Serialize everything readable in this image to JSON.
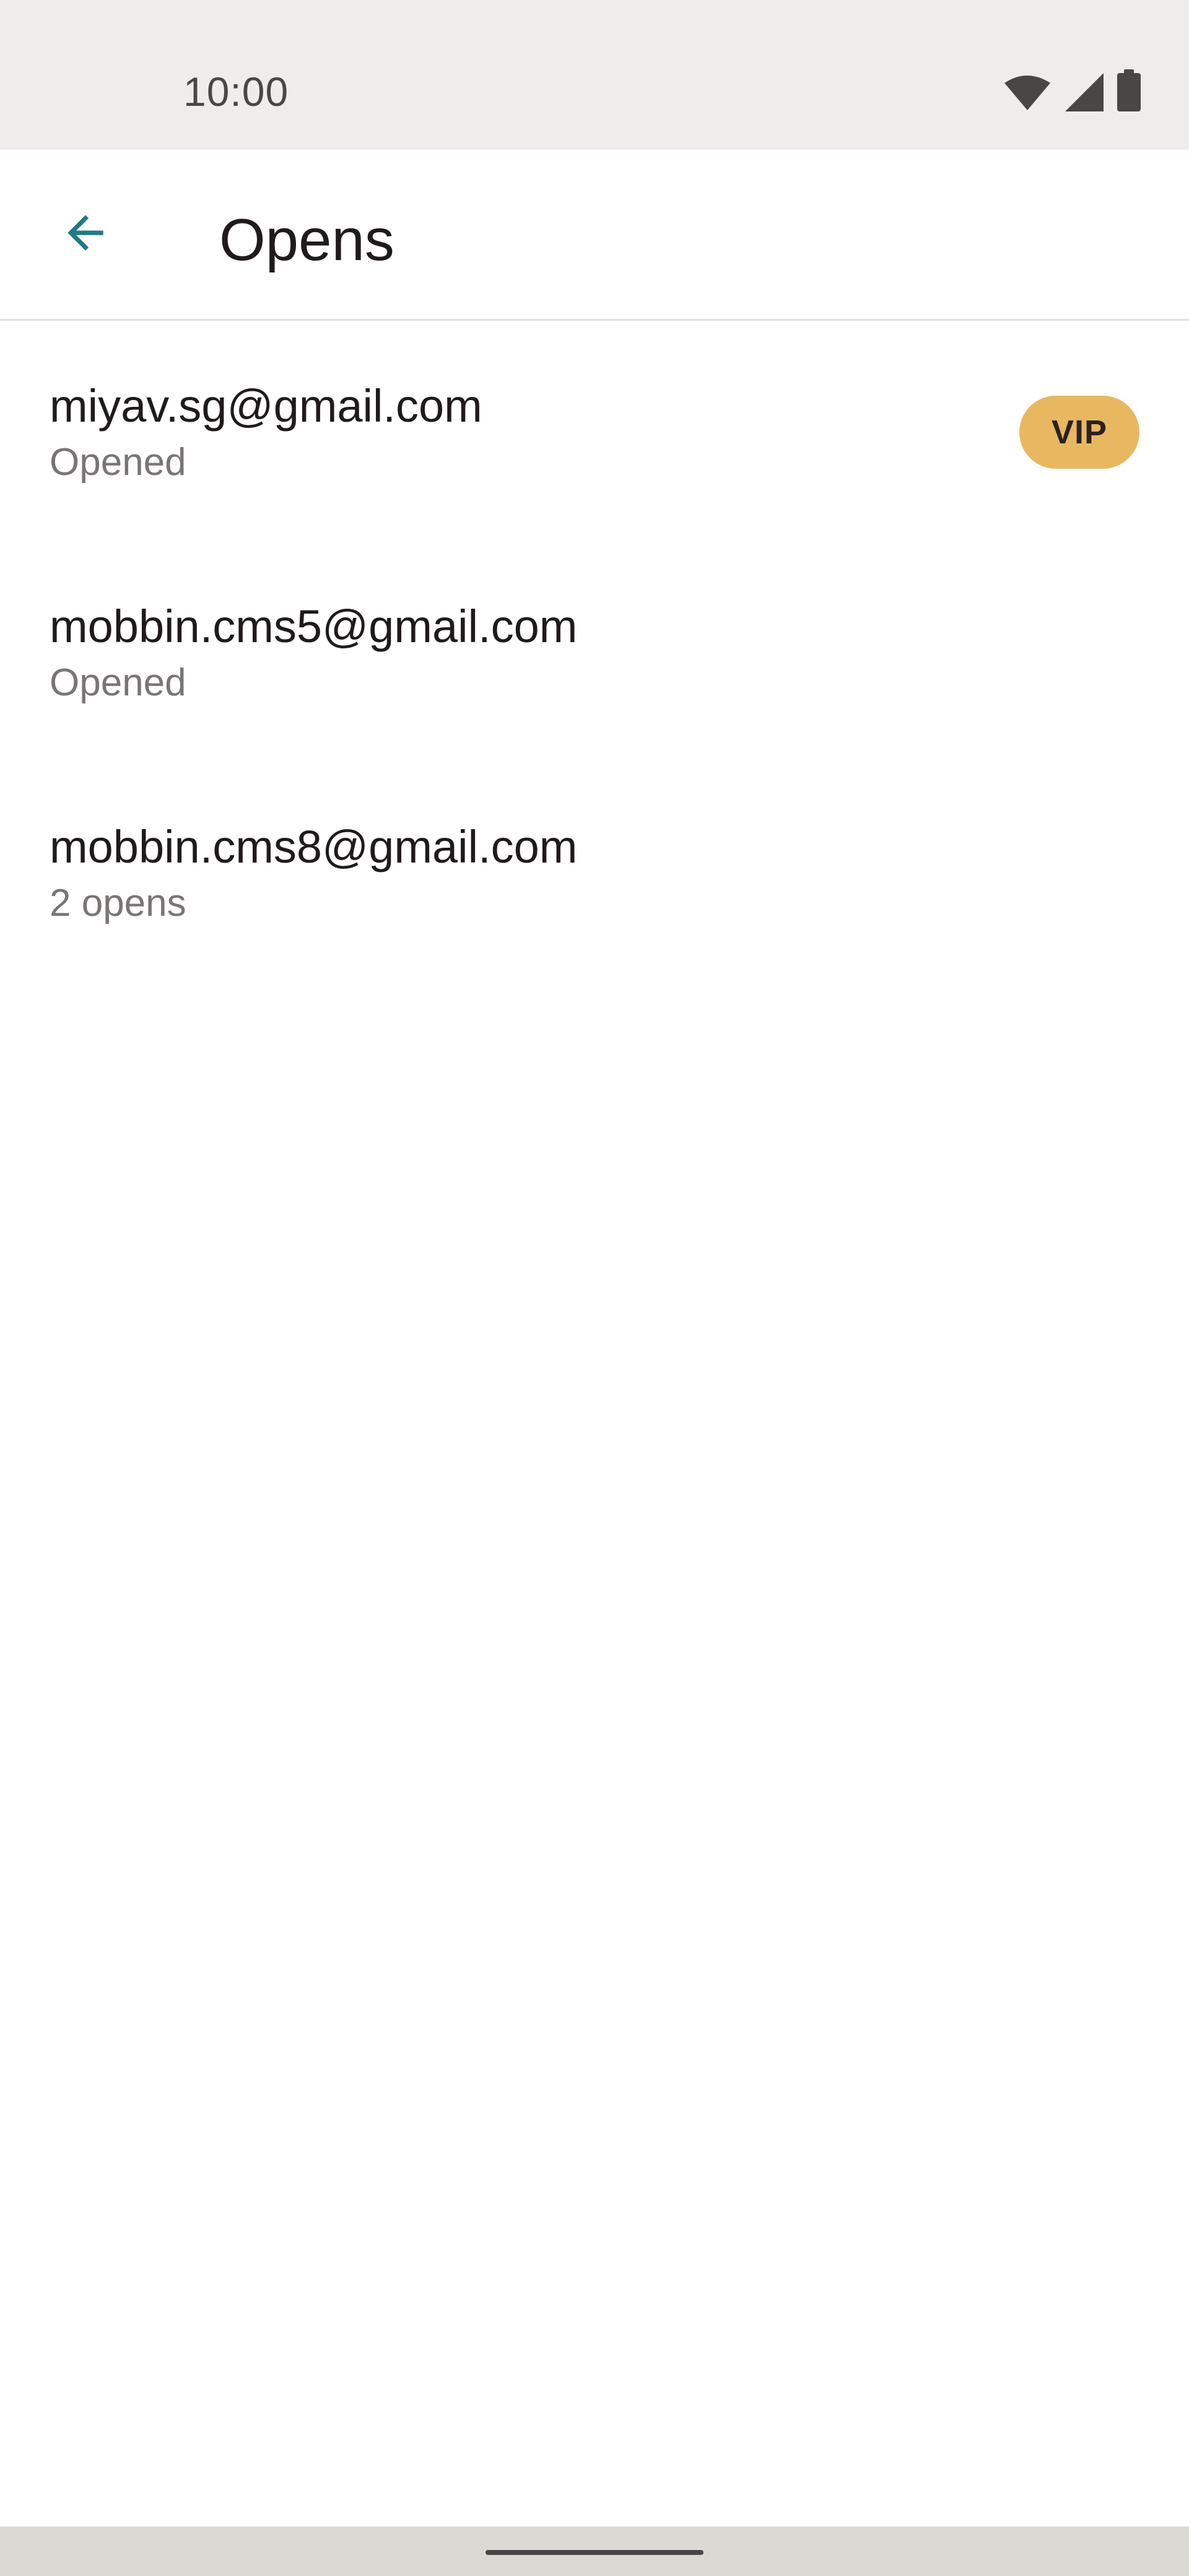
{
  "status_bar": {
    "time": "10:00",
    "icons": [
      "wifi-icon",
      "signal-icon",
      "battery-icon"
    ]
  },
  "header": {
    "back_icon": "arrow-back-icon",
    "title": "Opens"
  },
  "list": {
    "items": [
      {
        "email": "miyav.sg@gmail.com",
        "status": "Opened",
        "badge": "VIP"
      },
      {
        "email": "mobbin.cms5@gmail.com",
        "status": "Opened"
      },
      {
        "email": "mobbin.cms8@gmail.com",
        "status": "2 opens"
      }
    ]
  },
  "colors": {
    "status_bar_bg": "#f0ecec",
    "accent": "#1e7a86",
    "vip_badge": "#e8b860",
    "primary_text": "#1f1b1b",
    "secondary_text": "#7a7575"
  }
}
